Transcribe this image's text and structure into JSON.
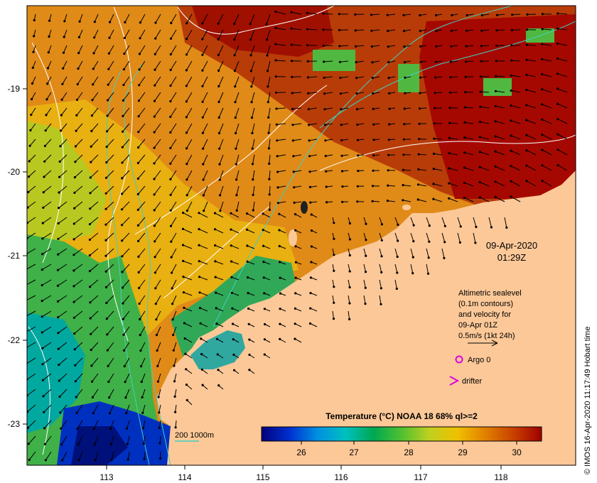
{
  "map": {
    "timestamp_date": "09-Apr-2020",
    "timestamp_time": "01:29Z",
    "x_ticks": [
      "113",
      "114",
      "115",
      "116",
      "117",
      "118"
    ],
    "y_ticks": [
      "-19",
      "-20",
      "-21",
      "-22",
      "-23"
    ],
    "legend": {
      "line1": "Altimetric sealevel",
      "line2": "(0.1m contours)",
      "line3": "and velocity for",
      "line4": "09-Apr 01Z",
      "line5": "0.5m/s (1kt 24h)"
    },
    "argo_label": "Argo 0",
    "drifter_label": "drifter",
    "bathymetry_label": "200  1000m",
    "colorbar_title": "Temperature (°C) NOAA 18 68% ql>=2",
    "colorbar_ticks": [
      "26",
      "27",
      "28",
      "29",
      "30"
    ],
    "credit": "© IMOS 16-Apr-2020 11:17:49 Hobart time"
  },
  "colors": {
    "land": "#fcc898",
    "contour": "#ffffff",
    "bathymetry": "#40d0c0",
    "argo_marker": "#e000e0",
    "drifter_marker": "#e000e0",
    "sst_scale": [
      "#00007a",
      "#0030d0",
      "#0090e0",
      "#00c0c0",
      "#00a850",
      "#50c030",
      "#c0d020",
      "#f0c000",
      "#e08000",
      "#c84000",
      "#a00000"
    ]
  }
}
